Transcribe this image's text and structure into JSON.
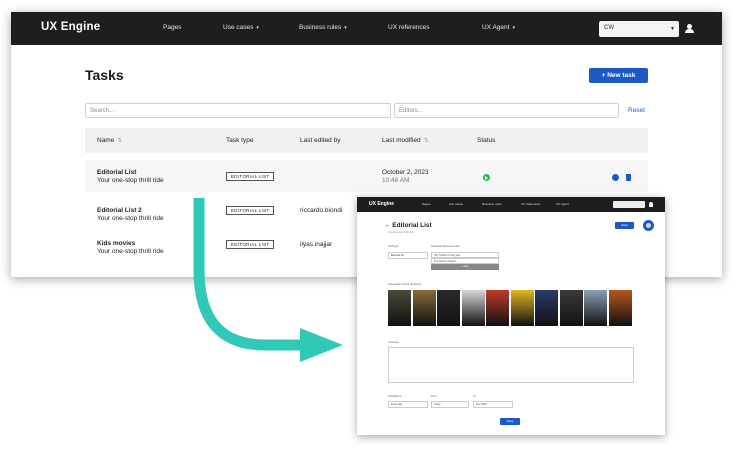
{
  "main": {
    "nav": {
      "brand": "UX Engine",
      "items": [
        {
          "label": "Pages",
          "caret": false
        },
        {
          "label": "Use cases",
          "caret": true
        },
        {
          "label": "Business rules",
          "caret": true
        },
        {
          "label": "UX references",
          "caret": false
        },
        {
          "label": "UX Agent",
          "caret": true
        }
      ],
      "workspace": "CW"
    },
    "title": "Tasks",
    "new_task_label": "+ New task",
    "search_placeholder": "Search...",
    "editors_placeholder": "Editors...",
    "reset_label": "Reset",
    "columns": [
      "Name",
      "Task type",
      "Last edited by",
      "Last modified",
      "Status"
    ],
    "rows": [
      {
        "name": "Editorial List",
        "subtitle": "Your one-stop thrill ride",
        "type": "EDITORIAL LIST",
        "editor": "",
        "modified_date": "October 2, 2023",
        "modified_time": "10:48 AM",
        "status": "active"
      },
      {
        "name": "Editorial List 2",
        "subtitle": "Your one-stop thrill ride",
        "type": "EDITORIAL LIST",
        "editor": "riccardo.biondi",
        "modified_date": "",
        "modified_time": "",
        "status": ""
      },
      {
        "name": "Kids movies",
        "subtitle": "Your one-stop thrill ride",
        "type": "EDITORIAL LIST",
        "editor": "ilyas.inajjar",
        "modified_date": "",
        "modified_time": "",
        "status": ""
      }
    ]
  },
  "detail": {
    "nav": {
      "brand": "UX Engine",
      "items": [
        "Pages",
        "Use cases",
        "Business rules",
        "UX references",
        "UX Agent"
      ]
    },
    "title": "← Editorial List",
    "subtitle": "Your one-stop thrill ride",
    "save_label": "Save",
    "field_label_1": "Task type",
    "field_value_1": "Editorial list",
    "field_label_2": "Associate Task Items with",
    "list_items": [
      "Top Thrillers of the year",
      "The all-time classics"
    ],
    "add_label": "+ Add",
    "posters_label": "Associated content (10 items)",
    "poster_colors": [
      "#4a4a3a",
      "#8a6a3a",
      "#2a2a2a",
      "#d8d8d8",
      "#c23a2a",
      "#e0b820",
      "#2a3a6a",
      "#3a3a3a",
      "#8aa0b8",
      "#b8561a"
    ],
    "notes_label": "Comment",
    "schedule_label": "Schedule by",
    "from_label": "From",
    "to_label": "To",
    "schedule_value": "Every day",
    "from_value": "Today",
    "to_value": "Dec 2023",
    "submit_label": "Save"
  },
  "colors": {
    "accent": "#1c58c8",
    "arrow": "#2fc9b6",
    "status_green": "#2db84c"
  }
}
